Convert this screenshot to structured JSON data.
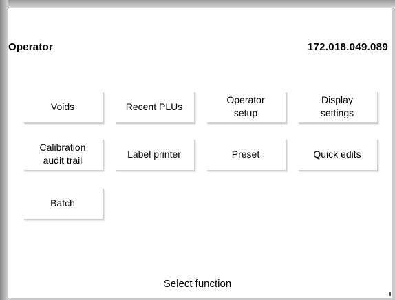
{
  "header": {
    "title": "Operator",
    "ip_address": "172.018.049.089"
  },
  "buttons": [
    {
      "label": "Voids"
    },
    {
      "label": "Recent PLUs"
    },
    {
      "label": "Operator\nsetup"
    },
    {
      "label": "Display\nsettings"
    },
    {
      "label": "Calibration\naudit trail"
    },
    {
      "label": "Label printer"
    },
    {
      "label": "Preset"
    },
    {
      "label": "Quick edits"
    },
    {
      "label": "Batch"
    }
  ],
  "status": {
    "message": "Select function"
  },
  "colors": {
    "background": "#ffffff",
    "frame": "#b8b8b8",
    "text": "#000000"
  }
}
